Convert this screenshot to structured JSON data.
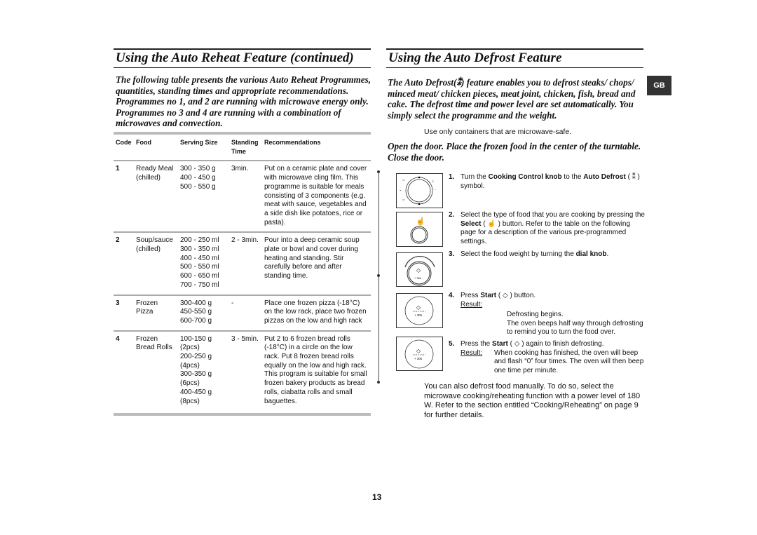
{
  "left": {
    "title": "Using the Auto Reheat Feature (continued)",
    "intro": "The following table presents the various Auto Reheat Programmes, quantities, standing times and appropriate recommendations. Programmes no 1, and 2 are running with microwave energy only. Programmes no 3 and 4 are running with a combination of microwaves and convection.",
    "table": {
      "headers": [
        "Code",
        "Food",
        "Serving Size",
        "Standing Time",
        "Recommendations"
      ],
      "rows": [
        {
          "code": "1",
          "food": [
            "Ready Meal",
            "(chilled)"
          ],
          "sizes": [
            "300 - 350 g",
            "400 - 450 g",
            "500 - 550 g"
          ],
          "time": "3min.",
          "rec": "Put on a ceramic plate and cover with microwave cling film. This programme is suitable for meals consisting of 3 components (e.g. meat with sauce, vegetables and a side dish like potatoes, rice or pasta)."
        },
        {
          "code": "2",
          "food": [
            "Soup/sauce",
            "(chilled)"
          ],
          "sizes": [
            "200 - 250 ml",
            "300 - 350 ml",
            "400 - 450 ml",
            "500 - 550 ml",
            "600 - 650 ml",
            "700 - 750 ml"
          ],
          "time": "2 - 3min.",
          "rec": "Pour into a deep ceramic soup plate or bowl and cover during heating and standing. Stir carefully before and after standing time."
        },
        {
          "code": "3",
          "food": [
            "Frozen",
            "Pizza"
          ],
          "sizes": [
            "300-400 g",
            "450-550 g",
            "600-700 g"
          ],
          "time": "-",
          "rec": "Place one frozen pizza (-18°C) on the low rack, place two frozen pizzas on the low and high rack"
        },
        {
          "code": "4",
          "food": [
            "Frozen",
            "Bread Rolls"
          ],
          "sizes": [
            "100-150 g",
            "(2pcs)",
            "200-250 g",
            "(4pcs)",
            "300-350 g",
            "(6pcs)",
            "400-450 g",
            "(8pcs)"
          ],
          "time": "3 - 5min.",
          "rec": "Put 2 to 6 frozen bread rolls (-18°C) in a circle on the low rack. Put 8 frozen bread rolls equally on the low and high rack. This program is suitable for small frozen bakery products as bread rolls, ciabatta rolls and small baguettes."
        }
      ]
    }
  },
  "right": {
    "title": "Using the Auto Defrost Feature",
    "badge": "GB",
    "intro_a": "The Auto Defrost(",
    "intro_b": ") feature enables you to defrost steaks/ chops/ minced meat/ chicken pieces, meat joint, chicken, fish, bread and cake. The defrost time and power level are set automatically. You simply select the programme and the weight.",
    "note": "Use only containers that are microwave-safe.",
    "open_door": "Open the door. Place the frozen food in the center of the turntable. Close the door.",
    "steps": [
      {
        "n": "1.",
        "a": "Turn the ",
        "b": "Cooking Control knob",
        "c": " to the ",
        "d": "Auto Defrost",
        "e": " ( ",
        "f": " ) symbol."
      },
      {
        "n": "2.",
        "a": "Select the type of food that you are cooking by pressing the ",
        "b": "Select",
        "c": " ( ",
        "d": " ) button. Refer to the table on the following page for a description of the various pre-programmed settings."
      },
      {
        "n": "3.",
        "a": "Select the food weight by turning the ",
        "b": "dial knob",
        "c": "."
      },
      {
        "n": "4.",
        "a": "Press ",
        "b": "Start",
        "c": " ( ",
        "d": " ) button.",
        "result_label": "Result:",
        "result": [
          "Defrosting begins.",
          "The oven beeps half way through defrosting to remind you to turn the food over."
        ]
      },
      {
        "n": "5.",
        "a": "Press the ",
        "b": "Start",
        "c": " ( ",
        "d": " ) again to finish defrosting.",
        "result_label": "Result:",
        "result": "When cooking has finished, the oven will beep and flash “0” four times. The oven will then beep one time per minute."
      }
    ],
    "dial_label": "+ 30s",
    "final": "You can also defrost food manually. To do so, select the microwave cooking/reheating function with a power level of 180 W. Refer to the section entitled “Cooking/Reheating” on page 9 for further details."
  },
  "page_number": "13"
}
